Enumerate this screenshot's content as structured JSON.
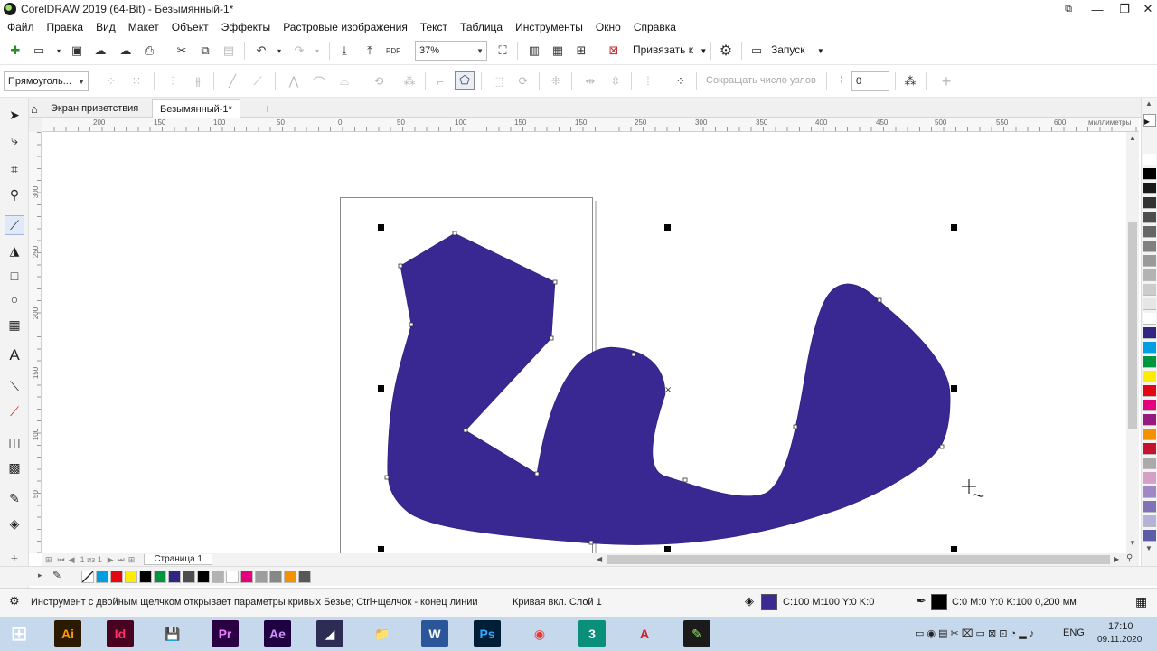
{
  "window": {
    "title": "CorelDRAW 2019 (64-Bit) - Безымянный-1*",
    "minimize": "—",
    "maximize": "❐",
    "close": "✕",
    "restore": "⧉"
  },
  "menu": [
    "Файл",
    "Правка",
    "Вид",
    "Макет",
    "Объект",
    "Эффекты",
    "Растровые изображения",
    "Текст",
    "Таблица",
    "Инструменты",
    "Окно",
    "Справка"
  ],
  "toolbar1": {
    "zoom": "37%",
    "snap_label": "Привязать к",
    "launch_label": "Запуск",
    "pdf_label": "PDF"
  },
  "toolbar2": {
    "object_type": "Прямоуголь...",
    "reduce_nodes": "Сокращать число узлов",
    "smoothing_value": "0"
  },
  "tabs": {
    "welcome": "Экран приветствия",
    "document": "Безымянный-1*",
    "add": "+"
  },
  "ruler": {
    "unit": "миллиметры",
    "h_labels": [
      "200",
      "150",
      "100",
      "50",
      "0",
      "50",
      "100",
      "150",
      "200",
      "250",
      "300",
      "350",
      "400",
      "450",
      "500",
      "550",
      "600"
    ],
    "v_labels": [
      "300",
      "250",
      "200",
      "150",
      "100",
      "50"
    ]
  },
  "pagenav": {
    "page_of": "1 из 1",
    "page_tab": "Страница 1"
  },
  "palette_colors": [
    "#ffffff",
    "#009fe3",
    "#e30613",
    "#ffed00",
    "#000000",
    "#009640",
    "#312783",
    "#4d4d4d",
    "#000000",
    "#b2b2b2",
    "#ffffff",
    "#e6007e",
    "#9d9d9c",
    "#878787",
    "#f39200",
    "#575756"
  ],
  "right_palette": [
    "#ffffff",
    "#000000",
    "#1a1a1a",
    "#333333",
    "#4d4d4d",
    "#666666",
    "#808080",
    "#999999",
    "#b3b3b3",
    "#cccccc",
    "#e6e6e6",
    "#ffffff",
    "#312783",
    "#009fe3",
    "#009640",
    "#ffed00",
    "#e30613",
    "#e6007e",
    "#951b81",
    "#f39200",
    "#c4122f",
    "#aaaaaa",
    "#d4a0c8",
    "#9f88c4",
    "#7f72b6",
    "#b3b3d9",
    "#5b5ea6"
  ],
  "status": {
    "hint": "Инструмент с двойным щелчком открывает параметры кривых Безье; Ctrl+щелчок - конец линии",
    "object_info": "Кривая вкл. Слой 1",
    "fill_value": "C:100 M:100 Y:0 K:0",
    "fill_color": "#3b2a92",
    "outline_value": "C:0 M:0 Y:0 K:100  0,200 мм",
    "outline_color": "#000000"
  },
  "shape": {
    "fill": "#3a2892"
  },
  "taskbar": {
    "apps": [
      {
        "name": "illustrator",
        "label": "Ai",
        "bg": "#2b1a00",
        "fg": "#ff9a00"
      },
      {
        "name": "indesign",
        "label": "Id",
        "bg": "#49021f",
        "fg": "#ff3366"
      },
      {
        "name": "save",
        "label": "💾",
        "bg": "#c6d8ec",
        "fg": "#1f4e9c"
      },
      {
        "name": "premiere",
        "label": "Pr",
        "bg": "#2a0043",
        "fg": "#e77cff"
      },
      {
        "name": "aftereffects",
        "label": "Ae",
        "bg": "#1f0040",
        "fg": "#d291ff"
      },
      {
        "name": "corel-photopaint",
        "label": "◢",
        "bg": "#2c2c54",
        "fg": "#ffffff"
      },
      {
        "name": "explorer",
        "label": "📁",
        "bg": "#c6d8ec",
        "fg": "#e8b43a"
      },
      {
        "name": "word",
        "label": "W",
        "bg": "#2b579a",
        "fg": "#ffffff"
      },
      {
        "name": "photoshop",
        "label": "Ps",
        "bg": "#001e36",
        "fg": "#31a8ff"
      },
      {
        "name": "chrome",
        "label": "◉",
        "bg": "#c6d8ec",
        "fg": "#e53935"
      },
      {
        "name": "3dsmax",
        "label": "3",
        "bg": "#0a8f7a",
        "fg": "#ffffff"
      },
      {
        "name": "autocad",
        "label": "A",
        "bg": "#c6d8ec",
        "fg": "#d7191c"
      },
      {
        "name": "coreldraw",
        "label": "✎",
        "bg": "#1b1b1b",
        "fg": "#9be36b"
      }
    ],
    "lang": "ENG",
    "time": "17:10",
    "date": "09.11.2020"
  }
}
